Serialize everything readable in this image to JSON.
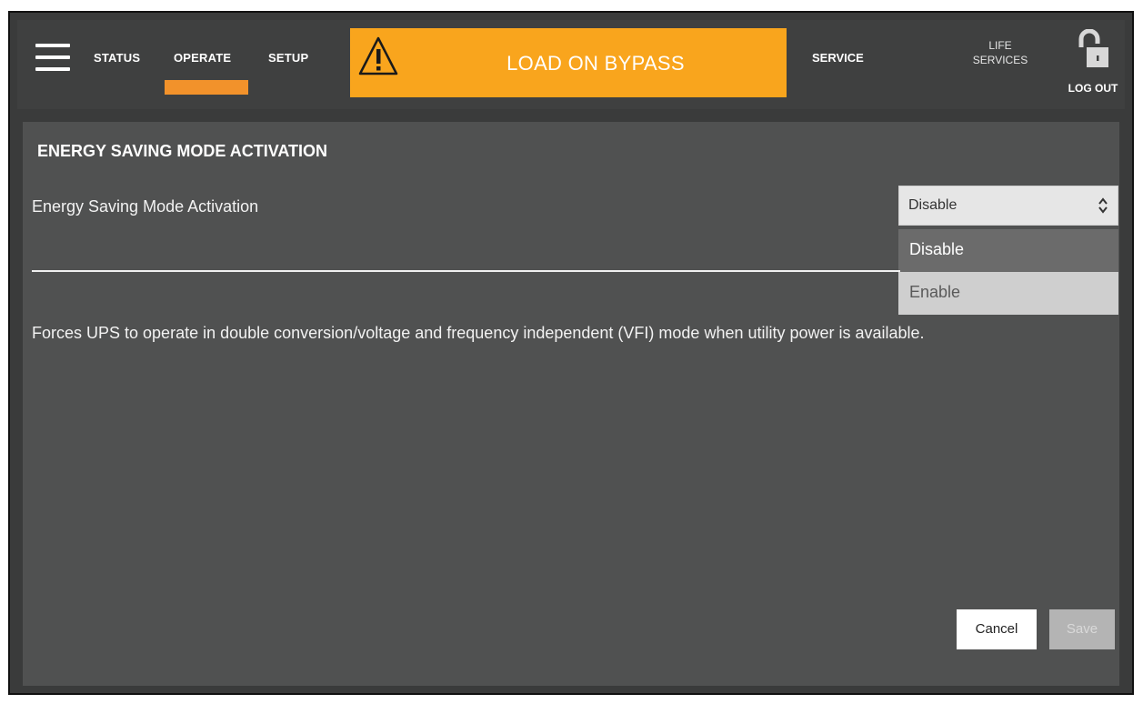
{
  "nav": {
    "tabs": [
      "STATUS",
      "OPERATE",
      "SETUP"
    ],
    "active_tab": "OPERATE",
    "alarm_text": "LOAD ON BYPASS",
    "service": "SERVICE",
    "life_line1": "LIFE",
    "life_line2": "SERVICES",
    "logout": "LOG OUT"
  },
  "page": {
    "title": "ENERGY SAVING MODE ACTIVATION",
    "field_label": "Energy Saving Mode Activation",
    "selected_value": "Disable",
    "options": [
      "Disable",
      "Enable"
    ],
    "description": "Forces UPS to operate in double conversion/voltage and frequency independent (VFI) mode when utility power is available."
  },
  "buttons": {
    "cancel": "Cancel",
    "save": "Save"
  },
  "colors": {
    "accent": "#f2922b",
    "alarm": "#f9a51d",
    "panel": "#505151",
    "bar": "#3f4040"
  }
}
